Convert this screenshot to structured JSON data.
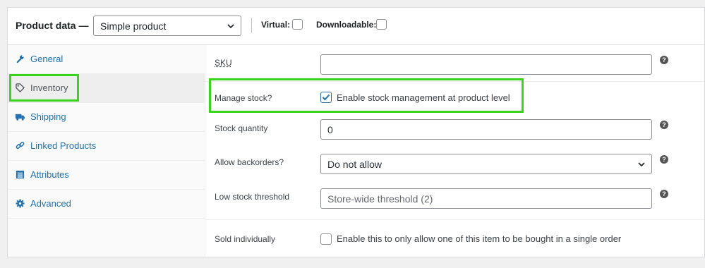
{
  "header": {
    "title": "Product data —",
    "product_type": "Simple product",
    "virtual_label": "Virtual:",
    "downloadable_label": "Downloadable:"
  },
  "tabs": [
    {
      "label": "General",
      "icon": "wrench-icon"
    },
    {
      "label": "Inventory",
      "icon": "tag-icon",
      "active": true
    },
    {
      "label": "Shipping",
      "icon": "truck-icon"
    },
    {
      "label": "Linked Products",
      "icon": "link-icon"
    },
    {
      "label": "Attributes",
      "icon": "list-icon"
    },
    {
      "label": "Advanced",
      "icon": "gear-icon"
    }
  ],
  "fields": {
    "sku_label": "SKU",
    "sku_value": "",
    "manage_stock_label": "Manage stock?",
    "manage_stock_text": "Enable stock management at product level",
    "manage_stock_checked": true,
    "stock_qty_label": "Stock quantity",
    "stock_qty_value": "0",
    "backorders_label": "Allow backorders?",
    "backorders_value": "Do not allow",
    "low_stock_label": "Low stock threshold",
    "low_stock_placeholder": "Store-wide threshold (2)",
    "sold_individually_label": "Sold individually",
    "sold_individually_text": "Enable this to only allow one of this item to be bought in a single order",
    "sold_individually_checked": false
  },
  "help_glyph": "?",
  "colors": {
    "accent": "#2271b1",
    "highlight": "#39d41c"
  }
}
